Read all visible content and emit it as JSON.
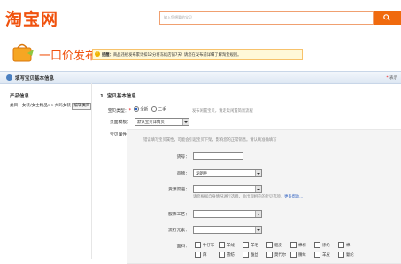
{
  "header": {
    "logo": "淘宝网",
    "search_placeholder": "输入您想要的宝贝"
  },
  "banner": {
    "title": "一口价发布",
    "notice_label": "提醒：",
    "notice_text": "商品违规发布累计扣12分将冻结店铺7天! 请您在发布前详细了解淘宝规则。",
    "notice_link": "淘宝规则"
  },
  "section": {
    "title": "填写宝贝基本信息",
    "required_hint_star": "*",
    "required_hint_text": "表示"
  },
  "product_info": {
    "title": "产品信息",
    "category_label": "类目：",
    "category_value": "女装/女士精品>>大码女装",
    "edit_button": "编辑类目"
  },
  "form": {
    "heading": "1. 宝贝基本信息",
    "type_label": "宝贝类型：",
    "type_required": "*",
    "type_options": [
      "全新",
      "二手"
    ],
    "type_selected": "全新",
    "type_hint": "发布闲置宝贝，请走卖闲置简易流程",
    "template_label": "页面模板：",
    "template_value": "默认宝贝详情页",
    "props_label": "宝贝属性：",
    "props_hint": "错误填写宝贝属性，可能会引起宝贝下架，影响您的正常销售。请认真准确填写",
    "model_label": "货号：",
    "model_value": "",
    "brand_label": "品牌：",
    "brand_value": "发朗手",
    "origin_label": "货源渠道：",
    "origin_value": "",
    "origin_hint": "请您根据自身情况进行选择，会出现相应的宝贝选项。",
    "origin_link": "更多帮助...",
    "craft_label": "服饰工艺：",
    "craft_value": "",
    "style_label": "流行元素：",
    "style_value": "",
    "fabric_label": "面料：",
    "fabric_row1": [
      "牛仔布",
      "羊绒",
      "羊毛",
      "貂皮",
      "棉棕",
      "涤纶",
      "棉"
    ],
    "fabric_row2": [
      "麻",
      "雪纺",
      "蚕丝",
      "莫代尔",
      "腈纶",
      "羊皮",
      "氨纶"
    ]
  }
}
